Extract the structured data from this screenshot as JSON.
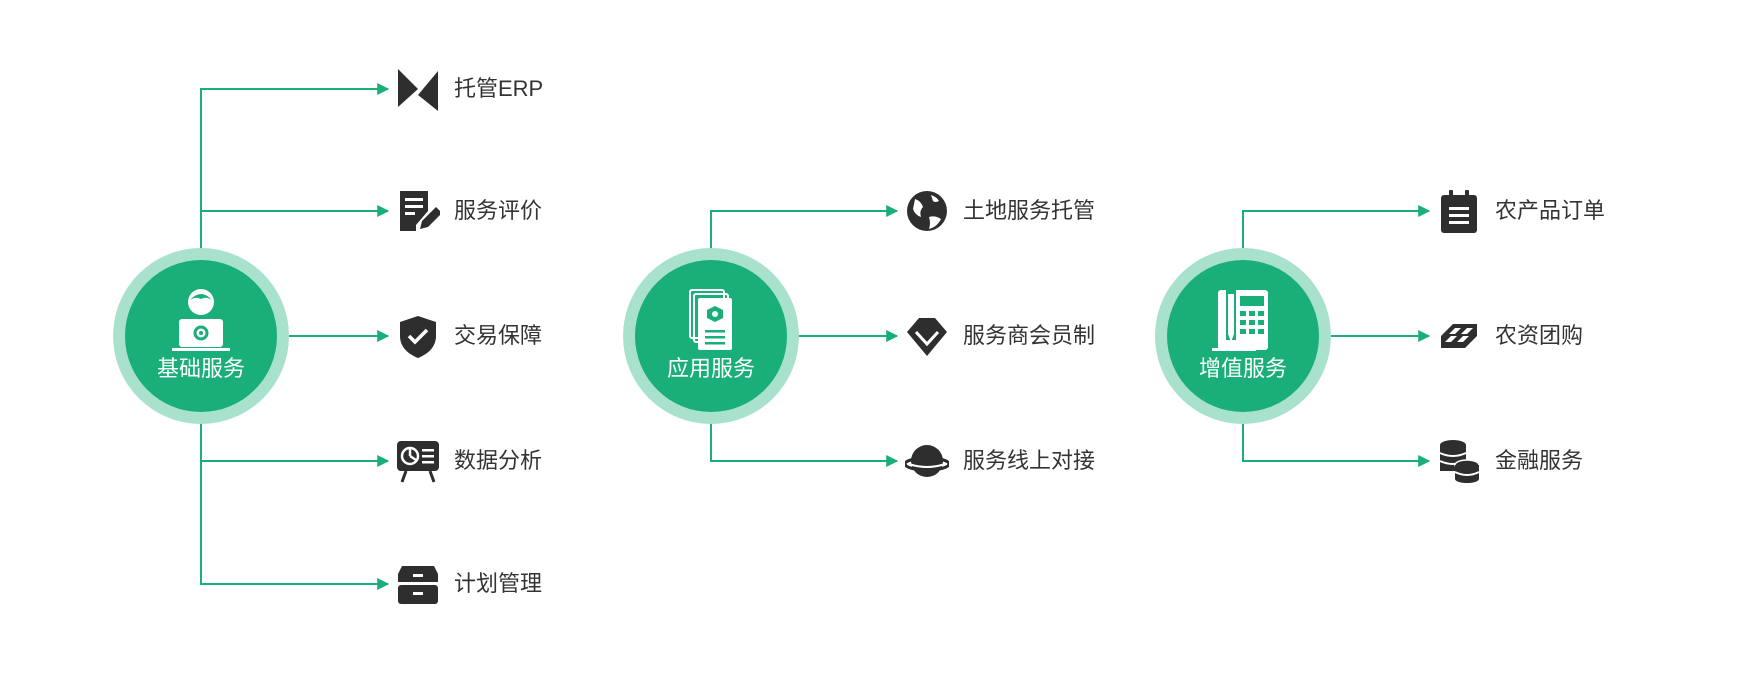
{
  "colors": {
    "accent": "#1aaf78",
    "ring": "#a9e2cc",
    "line": "#1aaf78",
    "icon": "#2e2e2e",
    "text": "#333333"
  },
  "groups": [
    {
      "title": "基础服务",
      "hub_icon": "user-laptop-gear-icon",
      "items": [
        {
          "label": "托管ERP",
          "icon": "triangles-icon"
        },
        {
          "label": "服务评价",
          "icon": "document-edit-icon"
        },
        {
          "label": "交易保障",
          "icon": "shield-check-icon"
        },
        {
          "label": "数据分析",
          "icon": "presentation-chart-icon"
        },
        {
          "label": "计划管理",
          "icon": "drawers-icon"
        }
      ]
    },
    {
      "title": "应用服务",
      "hub_icon": "document-stack-icon",
      "items": [
        {
          "label": "土地服务托管",
          "icon": "globe-icon"
        },
        {
          "label": "服务商会员制",
          "icon": "diamond-icon"
        },
        {
          "label": "服务线上对接",
          "icon": "planet-icon"
        }
      ]
    },
    {
      "title": "增值服务",
      "hub_icon": "calculator-pen-icon",
      "items": [
        {
          "label": "农产品订单",
          "icon": "clipboard-list-icon"
        },
        {
          "label": "农资团购",
          "icon": "grid-badge-icon"
        },
        {
          "label": "金融服务",
          "icon": "coins-stack-icon"
        }
      ]
    }
  ]
}
